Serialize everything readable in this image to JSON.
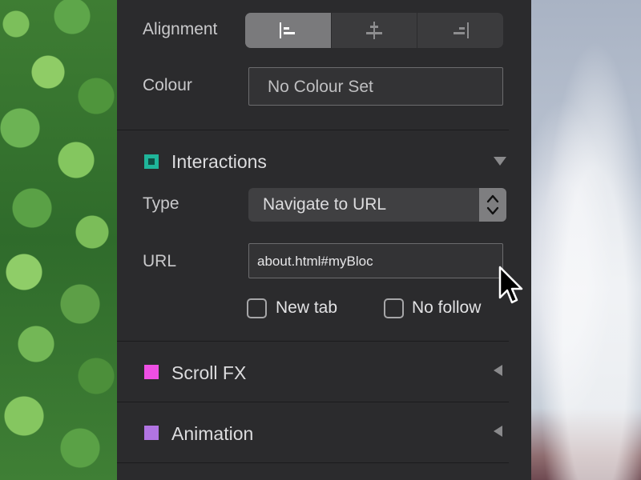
{
  "alignment": {
    "label": "Alignment",
    "options": [
      {
        "icon": "align-left-icon",
        "selected": true
      },
      {
        "icon": "align-center-icon",
        "selected": false
      },
      {
        "icon": "align-right-icon",
        "selected": false
      }
    ]
  },
  "colour": {
    "label": "Colour",
    "value": "No Colour Set"
  },
  "interactions": {
    "title": "Interactions",
    "color": "#1fb59a",
    "expanded": true,
    "type_label": "Type",
    "type_value": "Navigate to URL",
    "url_label": "URL",
    "url_value": "about.html#myBloc",
    "new_tab_label": "New tab",
    "new_tab_checked": false,
    "no_follow_label": "No follow",
    "no_follow_checked": false
  },
  "scroll_fx": {
    "title": "Scroll FX",
    "color": "#ee4fe4",
    "expanded": false
  },
  "animation": {
    "title": "Animation",
    "color": "#b174e2",
    "expanded": false
  }
}
